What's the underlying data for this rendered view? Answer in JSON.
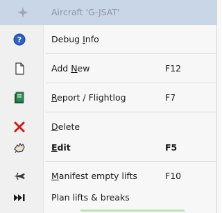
{
  "menu": {
    "header_title": "Aircraft 'G-JSAT'",
    "items": [
      {
        "pre": "Debug ",
        "ul": "I",
        "post": "nfo",
        "shortcut": "",
        "icon": "help-icon"
      },
      {
        "pre": "Add ",
        "ul": "N",
        "post": "ew",
        "shortcut": "F12",
        "icon": "new-document-icon"
      },
      {
        "pre": "",
        "ul": "R",
        "post": "eport / Flightlog",
        "shortcut": "F7",
        "icon": "report-book-icon"
      },
      {
        "pre": "",
        "ul": "D",
        "post": "elete",
        "shortcut": "",
        "icon": "delete-x-icon"
      },
      {
        "pre": "",
        "ul": "E",
        "post": "dit",
        "shortcut": "F5",
        "icon": "edit-hand-icon"
      },
      {
        "pre": "",
        "ul": "M",
        "post": "anifest empty lifts",
        "shortcut": "F10",
        "icon": "manifest-plane-icon"
      },
      {
        "pre": "Plan lifts & breaks",
        "ul": "",
        "post": "",
        "shortcut": "",
        "icon": "fast-forward-icon"
      }
    ],
    "colors": {
      "header": "#c9d6e8",
      "delete_icon": "#d11a1a",
      "help_icon": "#2f62c7"
    }
  }
}
